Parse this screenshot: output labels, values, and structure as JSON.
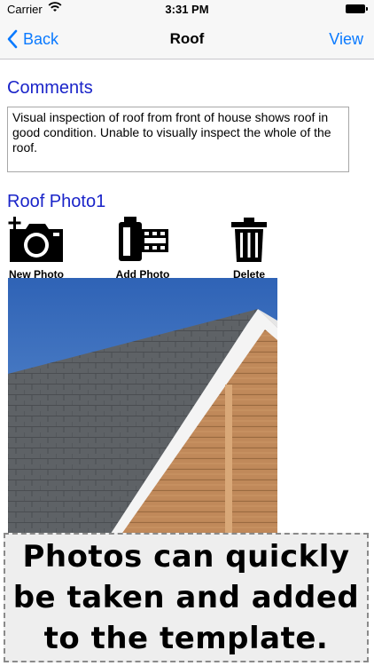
{
  "status_bar": {
    "carrier": "Carrier",
    "time": "3:31 PM"
  },
  "nav": {
    "back_label": "Back",
    "title": "Roof",
    "view_label": "View"
  },
  "comments": {
    "heading": "Comments",
    "text": "Visual inspection of roof from front of house shows roof in good condition. Unable to visually inspect the whole of the roof."
  },
  "photo_section": {
    "heading": "Roof Photo1",
    "new_photo_label": "New Photo",
    "add_photo_label": "Add Photo",
    "delete_label": "Delete"
  },
  "banner": {
    "text": "Photos can quickly be taken and added to the template."
  },
  "colors": {
    "accent": "#0a7aff",
    "heading": "#1a24c9"
  }
}
